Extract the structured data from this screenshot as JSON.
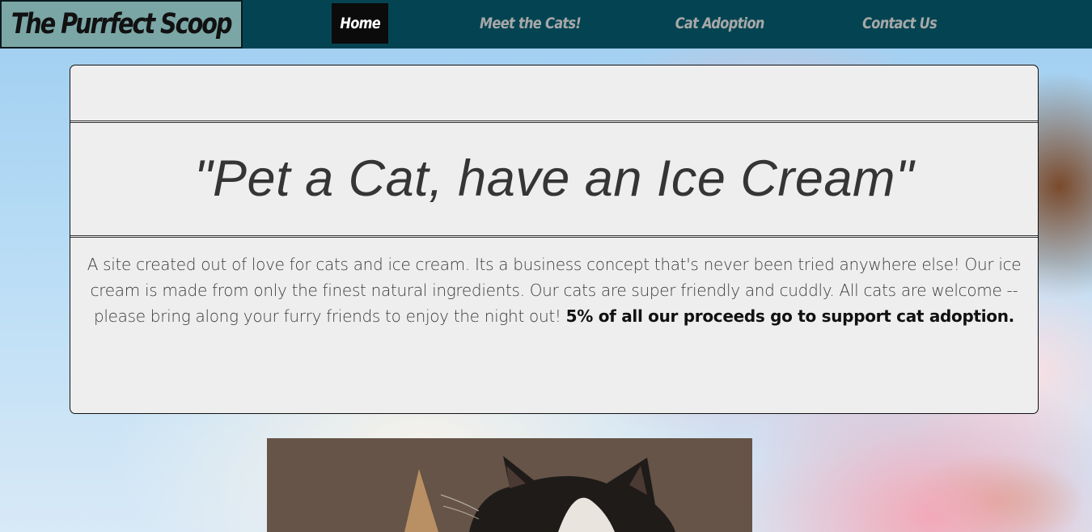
{
  "header": {
    "logo_text": "The Purrfect Scoop",
    "nav": [
      {
        "label": "Home",
        "active": true
      },
      {
        "label": "Meet the Cats!",
        "active": false
      },
      {
        "label": "Cat Adoption",
        "active": false
      },
      {
        "label": "Contact Us",
        "active": false
      }
    ]
  },
  "hero": {
    "headline": "\"Pet a Cat, have an Ice Cream\"",
    "blurb_text": "A site created out of love for cats and ice cream. Its a business concept that's never been tried anywhere else! Our ice cream is made from only the finest natural ingredients. Our cats are super friendly and cuddly. All cats are welcome -- please bring along your furry friends to enjoy the night out! ",
    "blurb_bold": "5% of all our proceeds go to support cat adoption."
  },
  "colors": {
    "navbar_bg": "#044452",
    "logo_bg": "#7ba6a6",
    "active_nav_bg": "#0b0b0b",
    "card_bg": "#eeeeee"
  }
}
